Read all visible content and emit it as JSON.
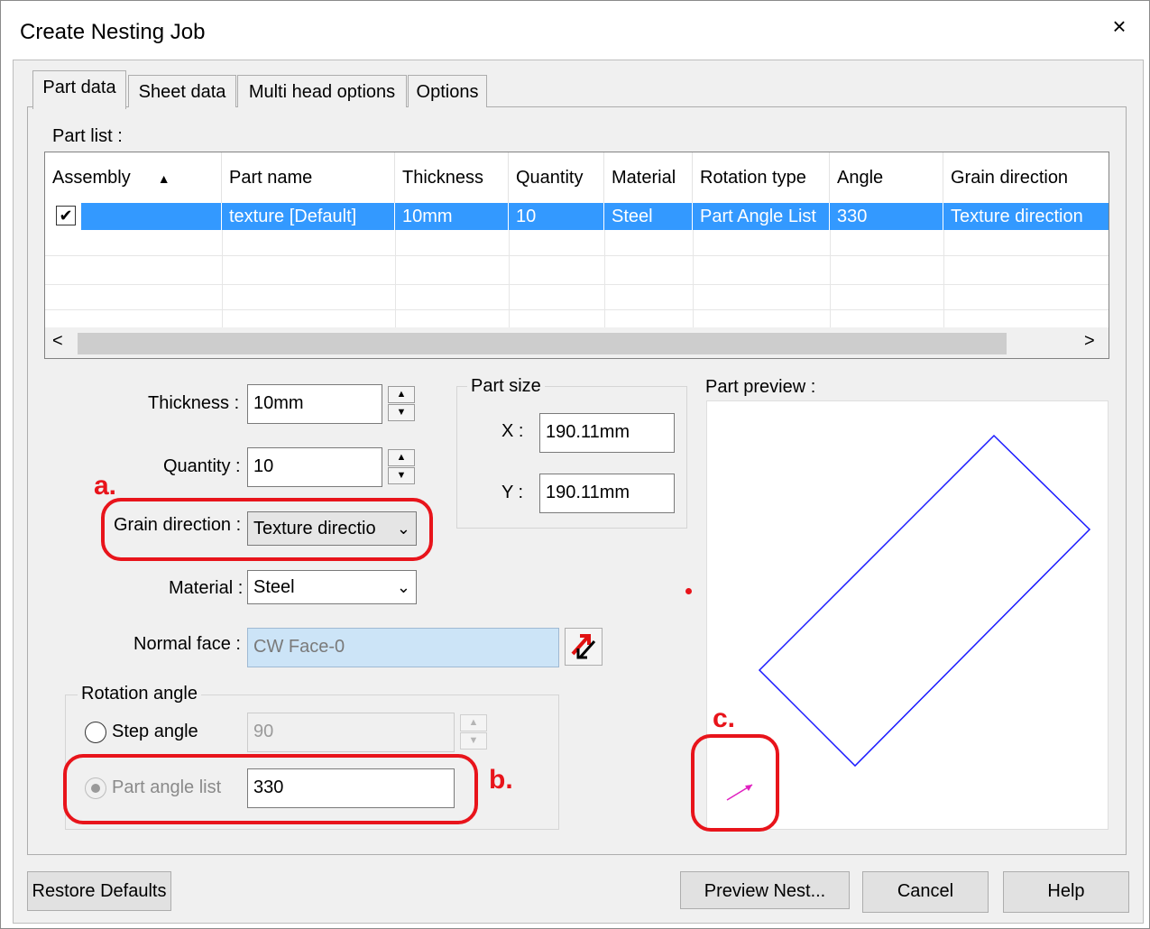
{
  "window": {
    "title": "Create Nesting Job",
    "close": "×"
  },
  "tabs": [
    "Part data",
    "Sheet data",
    "Multi head options",
    "Options"
  ],
  "part_list": {
    "label": "Part list :",
    "columns": [
      "Assembly",
      "Part name",
      "Thickness",
      "Quantity",
      "Material",
      "Rotation type",
      "Angle",
      "Grain direction"
    ],
    "sort_indicator": "▲",
    "rows": [
      {
        "assembly_checked": true,
        "part_name": "texture [Default]",
        "thickness": "10mm",
        "quantity": "10",
        "material": "Steel",
        "rotation_type": "Part Angle List",
        "angle": "330",
        "grain_direction": "Texture direction"
      }
    ],
    "scroll_left": "<",
    "scroll_right": ">"
  },
  "form": {
    "thickness_label": "Thickness :",
    "thickness_value": "10mm",
    "quantity_label": "Quantity :",
    "quantity_value": "10",
    "grain_label": "Grain direction :",
    "grain_value": "Texture directio",
    "material_label": "Material :",
    "material_value": "Steel",
    "normal_face_label": "Normal face :",
    "normal_face_value": "CW Face-0"
  },
  "part_size": {
    "title": "Part size",
    "x_label": "X :",
    "x_value": "190.11mm",
    "y_label": "Y :",
    "y_value": "190.11mm"
  },
  "rotation": {
    "title": "Rotation angle",
    "step_label": "Step angle",
    "step_value": "90",
    "list_label": "Part angle list",
    "list_value": "330",
    "selected": "Part angle list"
  },
  "preview": {
    "label": "Part preview :"
  },
  "annotations": {
    "a": "a.",
    "b": "b.",
    "c": "c."
  },
  "buttons": {
    "restore": "Restore Defaults",
    "preview_nest": "Preview Nest...",
    "cancel": "Cancel",
    "help": "Help"
  },
  "icons": {
    "spin_up": "▲",
    "spin_down": "▼",
    "dropdown": "⌄",
    "check": "✔"
  },
  "colors": {
    "selection": "#3399ff",
    "annotation": "#e8141b",
    "preview_outline": "#1a1aff",
    "grain_arrow": "#e020c0"
  }
}
